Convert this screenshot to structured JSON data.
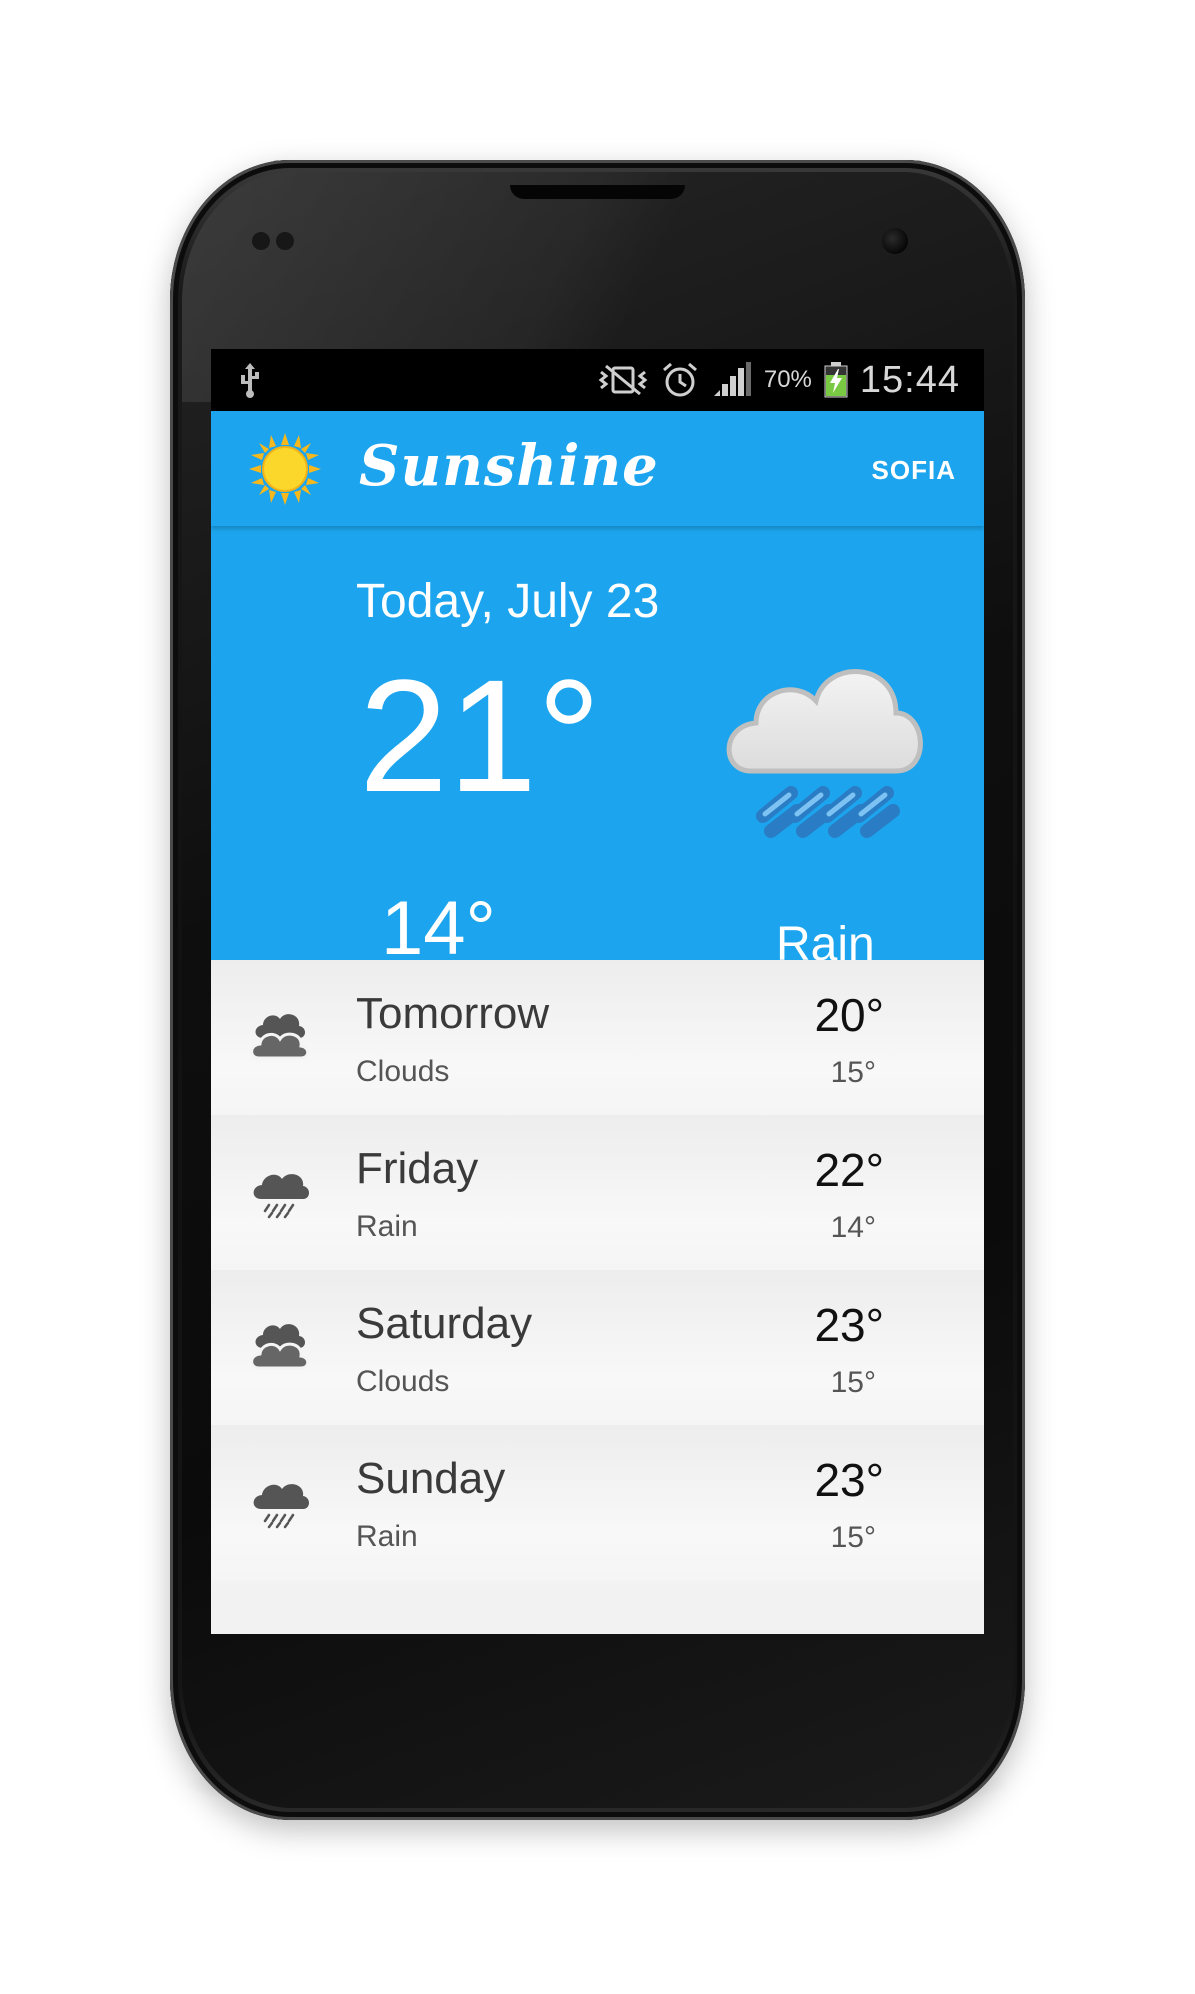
{
  "status_bar": {
    "battery_percent": "70%",
    "time": "15:44",
    "icons": [
      "usb-icon",
      "vibrate-icon",
      "alarm-icon",
      "signal-icon",
      "battery-charging-icon"
    ]
  },
  "action_bar": {
    "app_title": "Sunshine",
    "location": "SOFIA",
    "logo_icon": "sun-icon"
  },
  "today": {
    "date": "Today, July 23",
    "high": "21°",
    "low": "14°",
    "description": "Rain",
    "icon": "rain-icon"
  },
  "forecast": [
    {
      "day": "Tomorrow",
      "description": "Clouds",
      "high": "20°",
      "low": "15°",
      "icon": "clouds-icon"
    },
    {
      "day": "Friday",
      "description": "Rain",
      "high": "22°",
      "low": "14°",
      "icon": "rain-icon"
    },
    {
      "day": "Saturday",
      "description": "Clouds",
      "high": "23°",
      "low": "15°",
      "icon": "clouds-icon"
    },
    {
      "day": "Sunday",
      "description": "Rain",
      "high": "23°",
      "low": "15°",
      "icon": "rain-icon"
    }
  ],
  "colors": {
    "primary": "#1ca5ee",
    "list_background": "#f0f0f0",
    "phone_body": "#111111"
  }
}
